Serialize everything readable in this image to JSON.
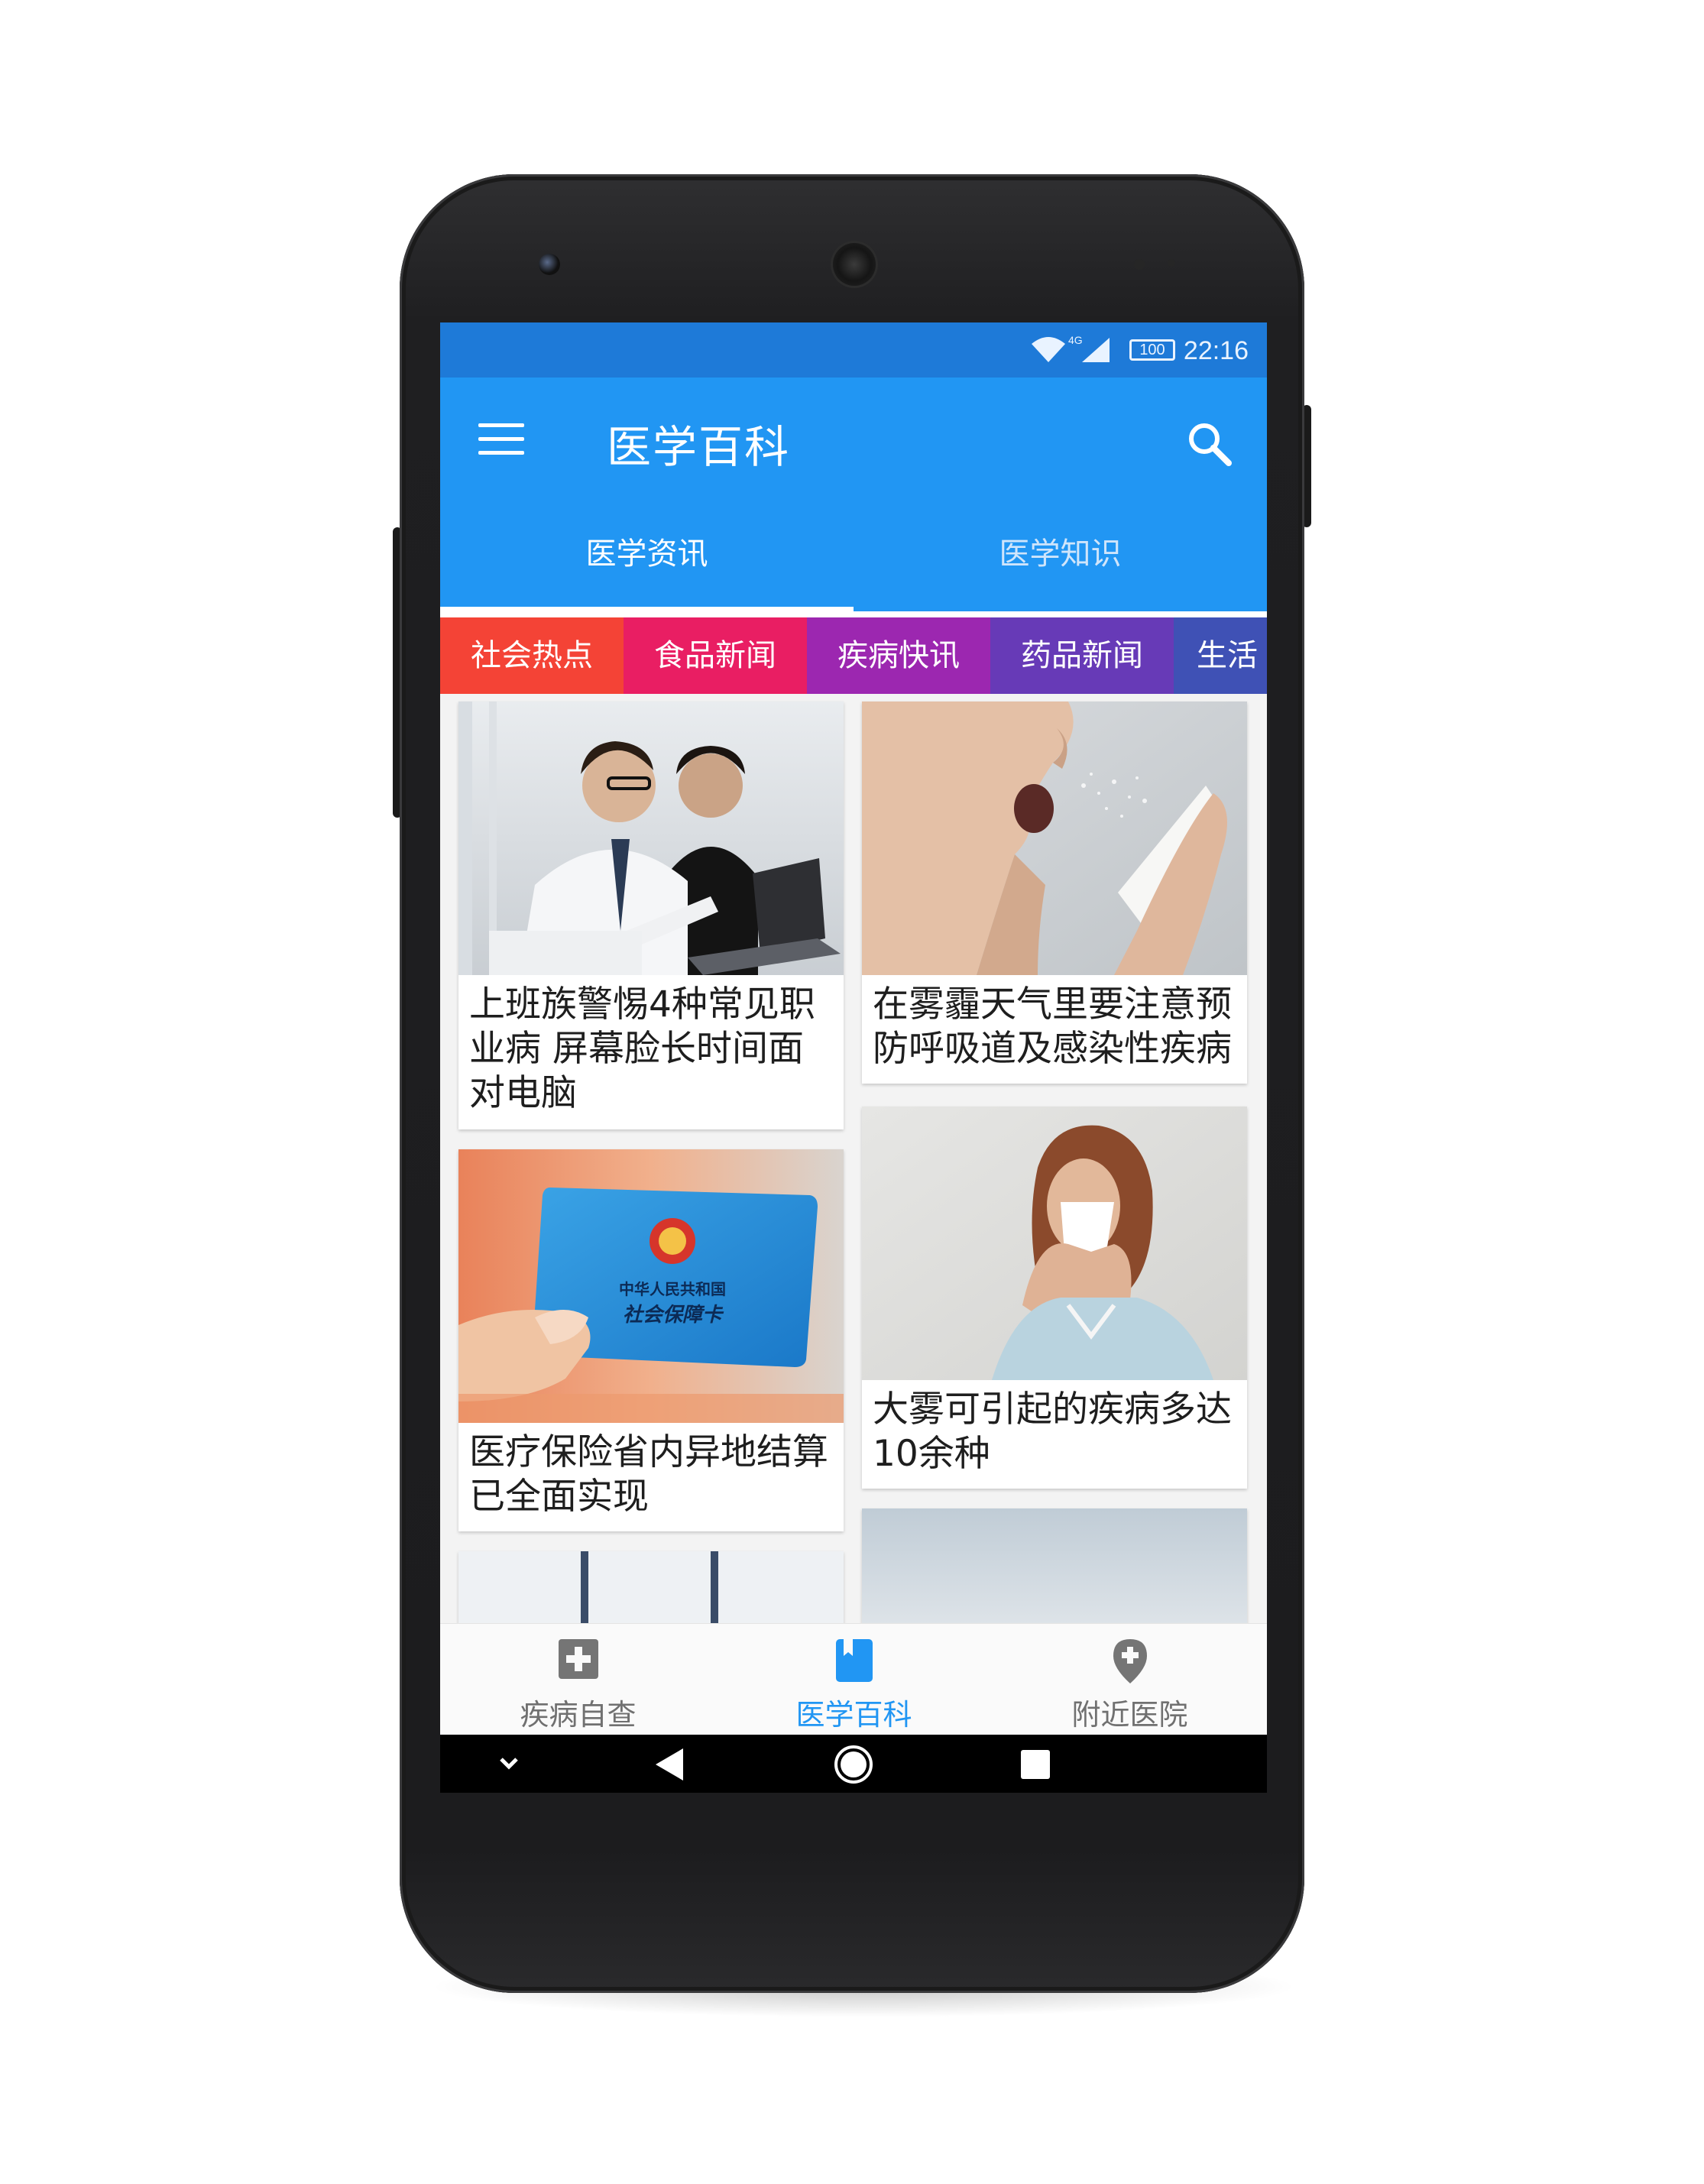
{
  "status_bar": {
    "time": "22:16",
    "battery": "100",
    "network": "4G"
  },
  "app_bar": {
    "title": "医学百科",
    "menu_icon": "hamburger-menu-icon",
    "search_icon": "search-icon"
  },
  "tabs": [
    {
      "label": "医学资讯",
      "active": true
    },
    {
      "label": "医学知识",
      "active": false
    }
  ],
  "categories": [
    {
      "label": "社会热点",
      "color": "#f44336"
    },
    {
      "label": "食品新闻",
      "color": "#e91e63"
    },
    {
      "label": "疾病快讯",
      "color": "#9c27b0"
    },
    {
      "label": "药品新闻",
      "color": "#673ab7"
    },
    {
      "label": "生活",
      "color": "#3f51b5"
    }
  ],
  "articles": [
    {
      "title": "上班族警惕4种常见职业病 屏幕脸长时间面对电脑",
      "image": "office-workers-laptop-photo"
    },
    {
      "title": "在雾霾天气里要注意预防呼吸道及感染性疾病",
      "image": "man-sneezing-photo"
    },
    {
      "title": "医疗保险省内异地结算已全面实现",
      "image": "social-security-card-photo"
    },
    {
      "title": "大雾可引起的疾病多达10余种",
      "image": "woman-blowing-nose-photo"
    }
  ],
  "social_card_text": {
    "line1": "中华人民共和国",
    "line2": "社会保障卡"
  },
  "bottom_nav": [
    {
      "label": "疾病自查",
      "icon": "medical-cross-icon",
      "active": false
    },
    {
      "label": "医学百科",
      "icon": "bookmark-book-icon",
      "active": true
    },
    {
      "label": "附近医院",
      "icon": "hospital-location-pin-icon",
      "active": false
    }
  ],
  "colors": {
    "primary": "#2196f3",
    "status_bar": "#1e7ad8",
    "inactive_text": "#707070"
  }
}
